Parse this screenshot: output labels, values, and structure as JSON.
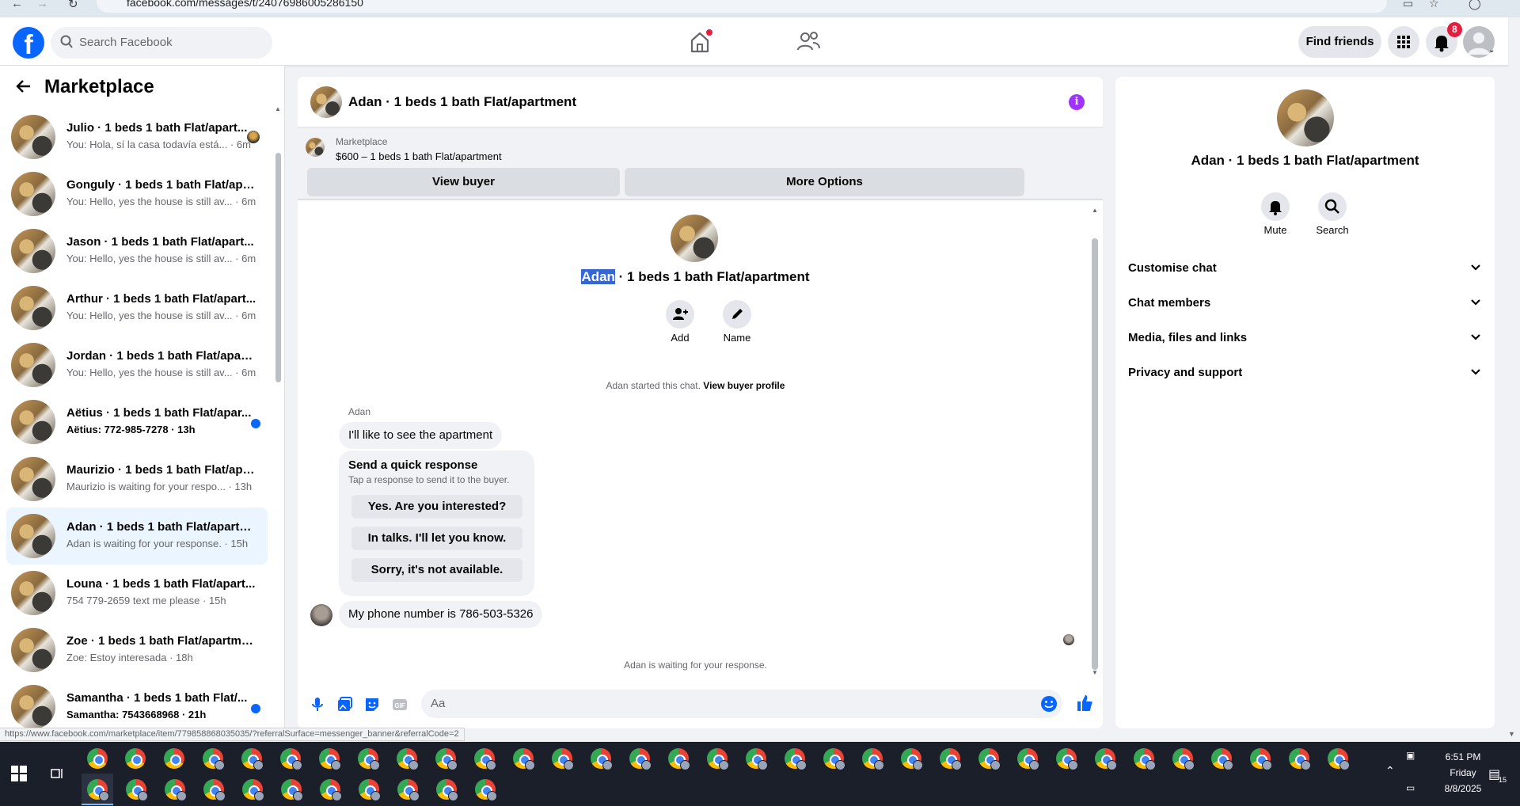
{
  "browser": {
    "url": "facebook.com/messages/t/24076986005286150"
  },
  "header": {
    "search_placeholder": "Search Facebook",
    "find_friends_label": "Find friends",
    "notification_count": "8"
  },
  "sidebar": {
    "title": "Marketplace",
    "conversations": [
      {
        "name": "Julio · 1 beds 1 bath Flat/apart...",
        "snippet": "You: Hola, sí la casa todavía está... · 6m",
        "unread": false
      },
      {
        "name": "Gonguly · 1 beds 1 bath Flat/apa...",
        "snippet": "You: Hello, yes the house is still av... · 6m",
        "unread": false
      },
      {
        "name": "Jason · 1 beds 1 bath Flat/apart...",
        "snippet": "You: Hello, yes the house is still av... · 6m",
        "unread": false
      },
      {
        "name": "Arthur · 1 beds 1 bath Flat/apart...",
        "snippet": "You: Hello, yes the house is still av... · 6m",
        "unread": false
      },
      {
        "name": "Jordan · 1 beds 1 bath Flat/apart...",
        "snippet": "You: Hello, yes the house is still av... · 6m",
        "unread": false
      },
      {
        "name": "Aëtius · 1 beds 1 bath Flat/apar...",
        "snippet": "Aëtius: 772-985-7278 · 13h",
        "unread": true
      },
      {
        "name": "Maurizio · 1 beds 1 bath Flat/apa...",
        "snippet": "Maurizio is waiting for your respo... · 13h",
        "unread": false
      },
      {
        "name": "Adan · 1 beds 1 bath Flat/apartm...",
        "snippet": "Adan is waiting for your response. · 15h",
        "unread": false
      },
      {
        "name": "Louna · 1 beds 1 bath Flat/apart...",
        "snippet": "754 779-2659 text me please · 15h",
        "unread": false
      },
      {
        "name": "Zoe · 1 beds 1 bath Flat/apartment",
        "snippet": "Zoe: Estoy interesada · 18h",
        "unread": false
      },
      {
        "name": "Samantha · 1 beds 1 bath Flat/...",
        "snippet": "Samantha: 7543668968 · 21h",
        "unread": true
      }
    ]
  },
  "chat": {
    "title": "Adan · 1 beds 1 bath Flat/apartment",
    "banner": {
      "label": "Marketplace",
      "listing": "$600 – 1 beds 1 bath Flat/apartment",
      "view_buyer_label": "View buyer",
      "more_options_label": "More Options"
    },
    "center_title_name": "Adan",
    "center_title_rest": " · 1 beds 1 bath Flat/apartment",
    "add_label": "Add",
    "name_label": "Name",
    "started_text": "Adan started this chat. ",
    "view_profile_link": "View buyer profile",
    "sender_name": "Adan",
    "message_1": "I'll like to see the apartment",
    "quick_response": {
      "title": "Send a quick response",
      "subtitle": "Tap a response to send it to the buyer.",
      "options": [
        "Yes. Are you interested?",
        "In talks. I'll let you know.",
        "Sorry, it's not available."
      ]
    },
    "message_2": "My phone number is 786-503-5326",
    "waiting_text": "Adan is waiting for your response.",
    "composer_placeholder": "Aa"
  },
  "details": {
    "title": "Adan · 1 beds 1 bath Flat/apartment",
    "mute_label": "Mute",
    "search_label": "Search",
    "sections": [
      "Customise chat",
      "Chat members",
      "Media, files and links",
      "Privacy and support"
    ]
  },
  "status_url": "https://www.facebook.com/marketplace/item/779858868035035/?referralSurface=messenger_banner&referralCode=2",
  "taskbar": {
    "time": "6:51 PM",
    "day": "Friday",
    "date": "8/8/2025",
    "notif_count": "15"
  }
}
